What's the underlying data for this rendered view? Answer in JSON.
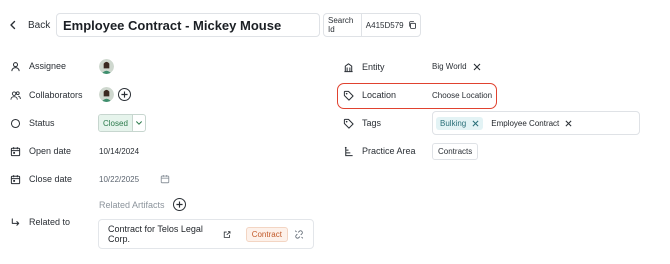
{
  "header": {
    "back_label": "Back",
    "title": "Employee Contract - Mickey Mouse",
    "search_id_label": "Search Id",
    "search_id_value": "A415D579"
  },
  "left_fields": {
    "assignee_label": "Assignee",
    "collaborators_label": "Collaborators",
    "status_label": "Status",
    "status_value": "Closed",
    "open_date_label": "Open date",
    "open_date_value": "10/14/2024",
    "close_date_label": "Close date",
    "close_date_value": "10/22/2025",
    "related_to_label": "Related to"
  },
  "related_artifacts": {
    "label": "Related Artifacts",
    "items": [
      {
        "name": "Contract for Telos Legal Corp.",
        "type": "Contract"
      }
    ]
  },
  "right_fields": {
    "entity_label": "Entity",
    "entity_value": "Big World",
    "location_label": "Location",
    "location_value": "Choose Location",
    "tags_label": "Tags",
    "tags": [
      "Bulking",
      "Employee Contract"
    ],
    "practice_area_label": "Practice Area",
    "practice_area_value": "Contracts"
  },
  "colors": {
    "status_green": "#2b7a4b",
    "highlight_red": "#e0422f",
    "tag_teal": "#2a6f78",
    "badge_orange": "#c25a2a"
  },
  "icons": [
    "chevron-left-icon",
    "copy-icon",
    "user-icon",
    "users-icon",
    "circle-icon",
    "calendar-icon",
    "corner-down-right-icon",
    "building-icon",
    "tag-icon",
    "tags-icon",
    "hierarchy-icon",
    "external-link-icon",
    "unlink-icon",
    "close-icon",
    "plus-circle-icon"
  ]
}
